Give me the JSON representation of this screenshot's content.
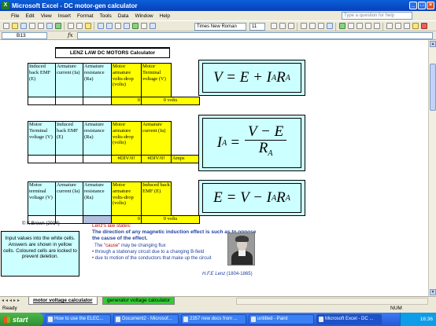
{
  "window": {
    "title": "Microsoft Excel - DC motor-gen calculator",
    "app_icon": "excel-icon"
  },
  "menu": {
    "items": [
      "File",
      "Edit",
      "View",
      "Insert",
      "Format",
      "Tools",
      "Data",
      "Window",
      "Help"
    ],
    "help_placeholder": "Type a question for help"
  },
  "toolbar": {
    "font_name": "Times New Roman",
    "font_size": "11"
  },
  "formula_bar": {
    "name_box": "B13",
    "fx": "fx",
    "content": ""
  },
  "sheet": {
    "title": "LENZ LAW DC MOTORS Calculator",
    "table1": {
      "headers": [
        "Induced back EMF (E)",
        "Armature current (Ia)",
        "Armature resistance (Ra)",
        "Motor armature volts-drop (volts)",
        "Motor Terminal voltage (V)"
      ],
      "results": [
        "0",
        "0 volts"
      ]
    },
    "table2": {
      "headers": [
        "Motor Terminal voltage (V)",
        "Induced back EMF (E)",
        "Armature resistance (Ra)",
        "Motor armature volts-drop (volts)",
        "Armature current (Ia)"
      ],
      "results": [
        "#DIV/0!",
        "#DIV/0!",
        "Amps"
      ]
    },
    "table3": {
      "headers": [
        "Motor terminal voltage (V)",
        "Armature current (Ia)",
        "Armature resistance (Ra)",
        "Motor armature volts-drop (volts)",
        "Induced back EMF (E)"
      ],
      "results": [
        "0",
        "0 volts"
      ]
    },
    "eq1": {
      "lhs": "V = E + I",
      "sub1": "A",
      "mid": "R",
      "sub2": "A"
    },
    "eq2": {
      "lhs": "I",
      "lhs_sub": "A",
      "num": "V − E",
      "den": "R",
      "den_sub": "A"
    },
    "eq3": {
      "lhs": "E = V − I",
      "sub1": "A",
      "mid": "R",
      "sub2": "A"
    },
    "copyright": "© K.Brown (2014)",
    "instructions": "Input values into the white cells. Answers are shown in yellow cells. Coloured cells are locked to prevent deletion.",
    "lenz": {
      "title": "Lenz's law states:",
      "statement": "The direction of any magnetic induction effect is such as to oppose the cause of the effect.",
      "cause_prefix": "The",
      "cause_word": "\"cause\"",
      "cause_suffix": "may be changing flux",
      "bullet1": "• through a stationary circuit due to a changing B-field",
      "bullet2": "• due to motion of the conductors that make up the circuit",
      "credit_name": "H.F.E Lenz",
      "credit_years": "(1804-1865)"
    }
  },
  "tabs": {
    "active": "motor voltage calculator",
    "inactive": "generator voltage calculator"
  },
  "status": {
    "left": "Ready",
    "right": "NUM"
  },
  "taskbar": {
    "start": "start",
    "items": [
      "How to use the ELEC...",
      "Document2 - Microsof...",
      "2357 new docs from ...",
      "untitled - Paint",
      "Microsoft Excel - DC ..."
    ],
    "clock": "16:36"
  }
}
